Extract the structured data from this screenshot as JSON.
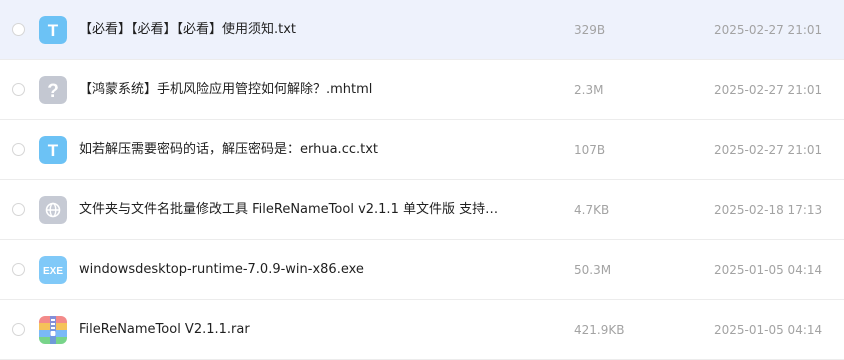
{
  "files": [
    {
      "name": "【必看】【必看】【必看】使用须知.txt",
      "size": "329B",
      "date": "2025-02-27 21:01",
      "icon": "text-file-icon",
      "selected": true
    },
    {
      "name": "【鸿蒙系统】手机风险应用管控如何解除？.mhtml",
      "size": "2.3M",
      "date": "2025-02-27 21:01",
      "icon": "unknown-file-icon",
      "selected": false
    },
    {
      "name": "如若解压需要密码的话，解压密码是：erhua.cc.txt",
      "size": "107B",
      "date": "2025-02-27 21:01",
      "icon": "text-file-icon",
      "selected": false
    },
    {
      "name": "文件夹与文件名批量修改工具 FileReNameTool v2.1.1 单文件版 支持…",
      "size": "4.7KB",
      "date": "2025-02-18 17:13",
      "icon": "web-link-icon",
      "selected": false
    },
    {
      "name": "windowsdesktop-runtime-7.0.9-win-x86.exe",
      "size": "50.3M",
      "date": "2025-01-05 04:14",
      "icon": "exe-file-icon",
      "selected": false
    },
    {
      "name": "FileReNameTool V2.1.1.rar",
      "size": "421.9KB",
      "date": "2025-01-05 04:14",
      "icon": "archive-file-icon",
      "selected": false
    }
  ],
  "colors": {
    "selected_row_bg": "#eef2fc",
    "text_icon": "#6cc2f5",
    "unknown_icon": "#b8bcc8",
    "web_icon": "#bfc4d0",
    "exe_icon": "#7cc6f7"
  }
}
